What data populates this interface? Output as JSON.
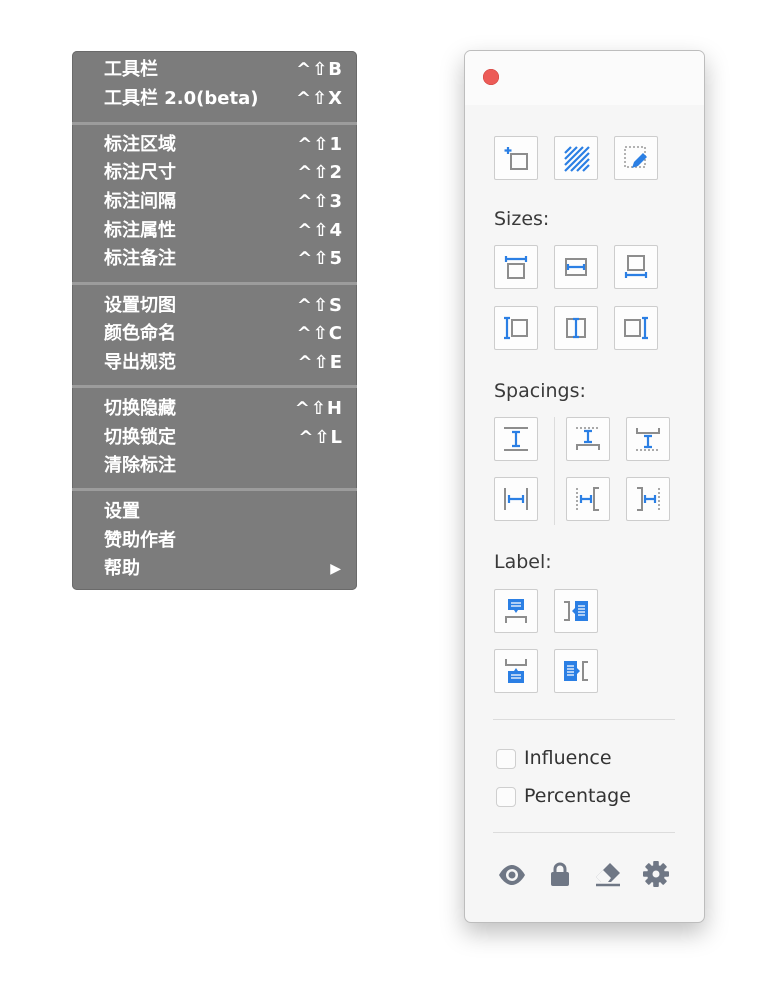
{
  "menu": {
    "groups": [
      [
        {
          "label": "工具栏",
          "shortcut": "^⇧B"
        },
        {
          "label": "工具栏 2.0(beta)",
          "shortcut": "^⇧X"
        }
      ],
      [
        {
          "label": "标注区域",
          "shortcut": "^⇧1"
        },
        {
          "label": "标注尺寸",
          "shortcut": "^⇧2"
        },
        {
          "label": "标注间隔",
          "shortcut": "^⇧3"
        },
        {
          "label": "标注属性",
          "shortcut": "^⇧4"
        },
        {
          "label": "标注备注",
          "shortcut": "^⇧5"
        }
      ],
      [
        {
          "label": "设置切图",
          "shortcut": "^⇧S"
        },
        {
          "label": "颜色命名",
          "shortcut": "^⇧C"
        },
        {
          "label": "导出规范",
          "shortcut": "^⇧E"
        }
      ],
      [
        {
          "label": "切换隐藏",
          "shortcut": "^⇧H"
        },
        {
          "label": "切换锁定",
          "shortcut": "^⇧L"
        },
        {
          "label": "清除标注",
          "shortcut": ""
        }
      ],
      [
        {
          "label": "设置",
          "shortcut": ""
        },
        {
          "label": "赞助作者",
          "shortcut": ""
        },
        {
          "label": "帮助",
          "shortcut": "",
          "submenu_arrow": "▶"
        }
      ]
    ]
  },
  "panel": {
    "sections": {
      "sizes": "Sizes:",
      "spacings": "Spacings:",
      "label": "Label:"
    },
    "options": {
      "influence": {
        "label": "Influence",
        "checked": false
      },
      "percentage": {
        "label": "Percentage",
        "checked": false
      }
    },
    "tools": {
      "top": [
        "new-artboard-icon",
        "hatch-overlay-icon",
        "color-picker-icon"
      ],
      "sizes": [
        "width-top-icon",
        "width-middle-icon",
        "width-bottom-icon",
        "height-left-icon",
        "height-center-icon",
        "height-right-icon"
      ],
      "spacings": [
        "spacing-vertical-icon",
        "spacing-top-icon",
        "spacing-bottom-icon",
        "spacing-horizontal-icon",
        "spacing-left-icon",
        "spacing-right-icon"
      ],
      "label": [
        "label-top-icon",
        "label-right-icon",
        "label-bottom-icon",
        "label-left-icon"
      ]
    },
    "footer_icons": [
      "eye-icon",
      "lock-icon",
      "eraser-icon",
      "gear-icon"
    ],
    "colors": {
      "accent": "#2b7fe4",
      "close": "#ec5b57",
      "menu_bg": "#7c7c7c",
      "icon_gray": "#6f7785"
    }
  }
}
